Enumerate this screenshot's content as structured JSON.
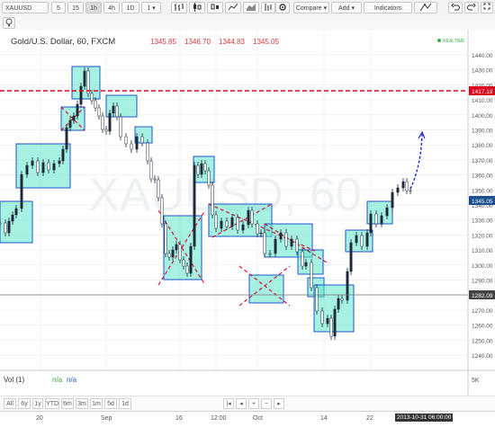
{
  "toolbar": {
    "symbol": "XAUUSD",
    "intervals": [
      "5",
      "15",
      "1h",
      "4h",
      "1D",
      "1"
    ],
    "active_interval": "1h",
    "compare_label": "Compare",
    "add_label": "Add",
    "indicators_label": "Indicators"
  },
  "legend": {
    "title": "Gold/U.S. Dollar, 60, FXCM",
    "open": "1345.85",
    "high": "1346.70",
    "low": "1344.83",
    "close": "1345.05",
    "realtime_label": "REALTIME"
  },
  "watermark": "XAUUSD, 60",
  "price_axis": {
    "ticks": [
      "1440.00",
      "1430.00",
      "1420.00",
      "1410.00",
      "1400.00",
      "1390.00",
      "1380.00",
      "1370.00",
      "1360.00",
      "1350.00",
      "1340.00",
      "1330.00",
      "1320.00",
      "1310.00",
      "1300.00",
      "1290.00",
      "1280.00",
      "1270.00",
      "1260.00",
      "1250.00",
      "1240.00"
    ],
    "resistance_label": "1417.19",
    "last_label": "1345.05",
    "support_label": "1282.09"
  },
  "colors": {
    "resistance": "#e0001b",
    "last": "#1a4f8f",
    "support": "#555555",
    "box_fill": "#4de0c8",
    "box_border": "#1c5bd6"
  },
  "volume": {
    "label": "Vol (1)",
    "value1": "n/a",
    "value2": "n/a",
    "axis_label": "5K"
  },
  "time_frames": [
    "All",
    "6y",
    "1y",
    "YTD",
    "6m",
    "3m",
    "1m",
    "5d",
    "1d"
  ],
  "x_axis": {
    "labels": [
      "20",
      "Sep",
      "16",
      "12:00",
      "Oct",
      "14",
      "22"
    ],
    "cursor_label": "2013-10-31 06:00:00"
  }
}
